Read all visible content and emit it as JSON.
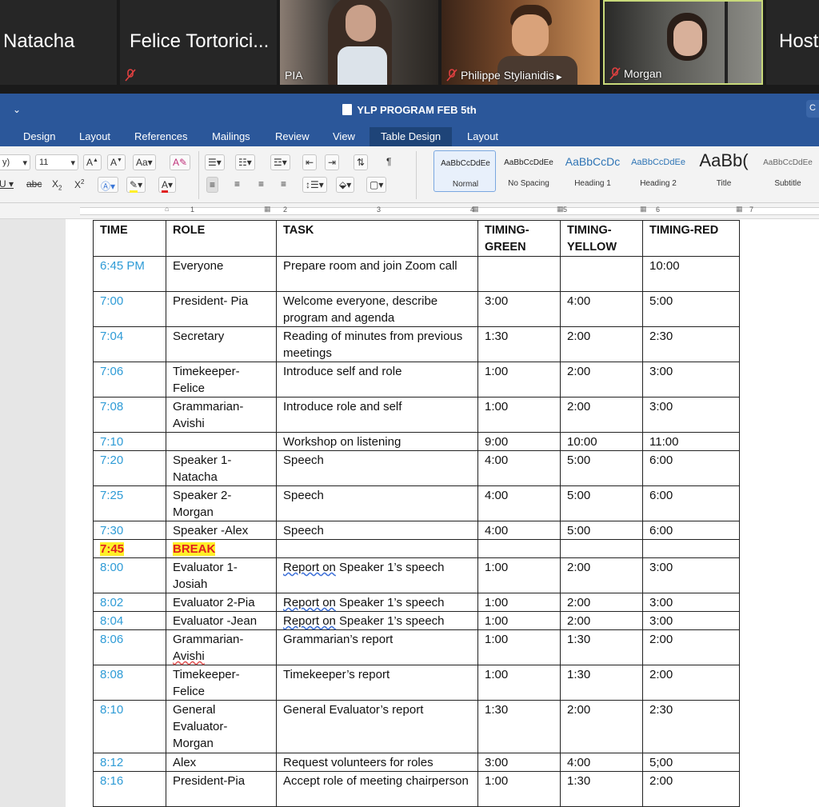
{
  "zoom": {
    "participants": [
      {
        "name": "Natacha",
        "type": "name"
      },
      {
        "name": "Felice Tortorici...",
        "type": "name",
        "muted": true
      },
      {
        "name": "PIA",
        "type": "video"
      },
      {
        "name": "Philippe Stylianidis",
        "type": "video",
        "muted": true
      },
      {
        "name": "Morgan",
        "type": "video",
        "muted": true,
        "active": true
      },
      {
        "name": "Host",
        "type": "name"
      }
    ]
  },
  "word": {
    "title": "YLP PROGRAM FEB 5th",
    "tabs": [
      "Design",
      "Layout",
      "References",
      "Mailings",
      "Review",
      "View",
      "Table Design",
      "Layout"
    ],
    "selected_tab": "Table Design",
    "font": {
      "name": "y)",
      "size": "11"
    },
    "styles": [
      {
        "preview": "AaBbCcDdEe",
        "name": "Normal"
      },
      {
        "preview": "AaBbCcDdEe",
        "name": "No Spacing"
      },
      {
        "preview": "AaBbCcDc",
        "name": "Heading 1"
      },
      {
        "preview": "AaBbCcDdEe",
        "name": "Heading 2"
      },
      {
        "preview": "AaBb(",
        "name": "Title"
      },
      {
        "preview": "AaBbCcDdEe",
        "name": "Subtitle"
      }
    ],
    "ruler_numbers": [
      "1",
      "2",
      "3",
      "4",
      "5",
      "6",
      "7"
    ]
  },
  "table": {
    "headers": [
      "TIME",
      "ROLE",
      "TASK",
      "TIMING-\nGREEN",
      "TIMING-\nYELLOW",
      "TIMING-RED"
    ],
    "rows": [
      [
        "6:45 PM",
        "Everyone",
        "Prepare room and join Zoom call",
        "",
        "",
        "10:00"
      ],
      [
        "7:00",
        "President- Pia",
        "Welcome everyone, describe program and agenda",
        "3:00",
        "4:00",
        "5:00"
      ],
      [
        "7:04",
        "Secretary",
        "Reading of minutes from previous meetings",
        "1:30",
        "2:00",
        "2:30"
      ],
      [
        "7:06",
        "Timekeeper-\nFelice",
        "Introduce self and role",
        "1:00",
        "2:00",
        "3:00"
      ],
      [
        "7:08",
        "Grammarian-\nAvishi",
        "Introduce role and self",
        "1:00",
        "2:00",
        "3:00"
      ],
      [
        "7:10",
        "",
        "Workshop on listening",
        "9:00",
        "10:00",
        "11:00"
      ],
      [
        "7:20",
        "Speaker 1-\nNatacha",
        "Speech",
        "4:00",
        "5:00",
        "6:00"
      ],
      [
        "7:25",
        "Speaker 2-\nMorgan",
        "Speech",
        "4:00",
        "5:00",
        "6:00"
      ],
      [
        "7:30",
        "Speaker -Alex",
        "Speech",
        "4:00",
        "5:00",
        "6:00"
      ],
      [
        "7:45",
        "BREAK",
        "",
        "",
        "",
        ""
      ],
      [
        "8:00",
        "Evaluator 1-\nJosiah",
        "Report  on Speaker 1’s speech",
        "1:00",
        "2:00",
        "3:00"
      ],
      [
        "8:02",
        "Evaluator 2-Pia",
        "Report  on Speaker 1’s speech",
        "1:00",
        "2:00",
        "3:00"
      ],
      [
        "8:04",
        "Evaluator -Jean",
        "Report  on Speaker 1’s speech",
        "1:00",
        "2:00",
        "3:00"
      ],
      [
        "8:06",
        "Grammarian-\nAvishi",
        "Grammarian’s report",
        "1:00",
        "1:30",
        "2:00"
      ],
      [
        "8:08",
        "Timekeeper-\nFelice",
        "Timekeeper’s report",
        "1:00",
        "1:30",
        "2:00"
      ],
      [
        "8:10",
        "General\nEvaluator-\nMorgan",
        "General Evaluator’s report",
        "1:30",
        "2:00",
        "2:30"
      ],
      [
        "8:12",
        "Alex",
        "Request volunteers for roles",
        "3:00",
        "4:00",
        "5;00"
      ],
      [
        "8:16",
        "President-Pia",
        "Accept role of meeting chairperson",
        "1:00",
        "1:30",
        "2:00"
      ]
    ],
    "colors": {
      "time": "#2e9bd6",
      "break_bg": "#ffef2a",
      "break_text": "#e02020"
    }
  }
}
